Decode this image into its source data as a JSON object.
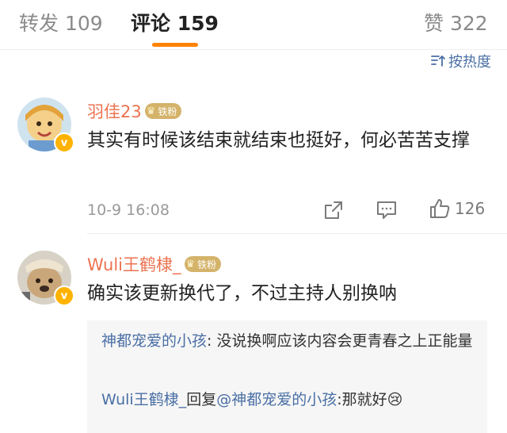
{
  "tabs": {
    "repost": "转发 109",
    "comments": "评论 159",
    "likes": "赞 322"
  },
  "sort": {
    "label": "按热度"
  },
  "comments": [
    {
      "username": "羽佳23",
      "badge": "铁粉",
      "text": "其实有时候该结束就结束也挺好，何必苦苦支撑",
      "time": "10-9 16:08",
      "like_count": "126"
    },
    {
      "username": "Wuli王鹤棣_",
      "badge": "铁粉",
      "text": "确实该更新换代了，不过主持人别换呐"
    }
  ],
  "replies": [
    {
      "author": "神都宠爱的小孩",
      "text": ": 没说换啊应该内容会更青春之上正能量"
    },
    {
      "author": "Wuli王鹤棣_",
      "reply_word": "回复",
      "mention": "@神都宠爱的小孩",
      "text": ":那就好",
      "emoji": "😢"
    }
  ],
  "colors": {
    "accent": "#ff8200",
    "username": "#eb7350",
    "link": "#4a6fa5",
    "badge": "#d4b36a"
  }
}
